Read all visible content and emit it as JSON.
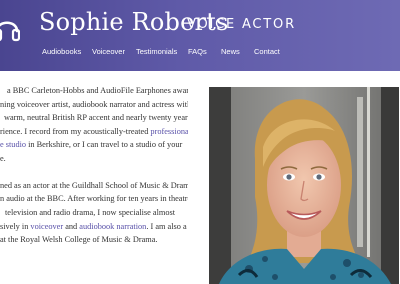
{
  "header": {
    "brand_name": "Sophie Roberts",
    "brand_title": "VOICE ACTOR",
    "logo_icon": "headphones-icon"
  },
  "nav": {
    "items": [
      {
        "label": "Audiobooks"
      },
      {
        "label": "Voiceover"
      },
      {
        "label": "Testimonials"
      },
      {
        "label": "FAQs"
      },
      {
        "label": "News"
      },
      {
        "label": "Contact"
      }
    ]
  },
  "intro": {
    "p1": {
      "l1": "a BBC Carleton-Hobbs and AudioFile Earphones award-",
      "l2": "ning voiceover artist, audiobook narrator and actress with a",
      "l3": "warm, neutral British RP accent and nearly twenty years'",
      "l4a": "rience. I record from my acoustically-treated ",
      "l4_link": "professional",
      "l5_link": "e studio",
      "l5b": " in Berkshire, or I can travel to a studio of your",
      "l6": "e."
    },
    "p2": {
      "l1": "ned as an actor at the Guildhall School of Music & Drama,",
      "l2": "n audio at the BBC. After working for ten years in theatre,",
      "l3": "television and radio drama, I now specialise almost",
      "l4a": "sively in ",
      "l4_link1": "voiceover",
      "l4b": " and ",
      "l4_link2": "audiobook narration",
      "l4c": ". I am also a",
      "l5": "at the Royal Welsh College of Music & Drama."
    }
  },
  "photo": {
    "subject": "portrait-photo"
  },
  "colors": {
    "header_start": "#4a4590",
    "header_end": "#6e6ab4",
    "link": "#5850a8",
    "text": "#333333"
  }
}
